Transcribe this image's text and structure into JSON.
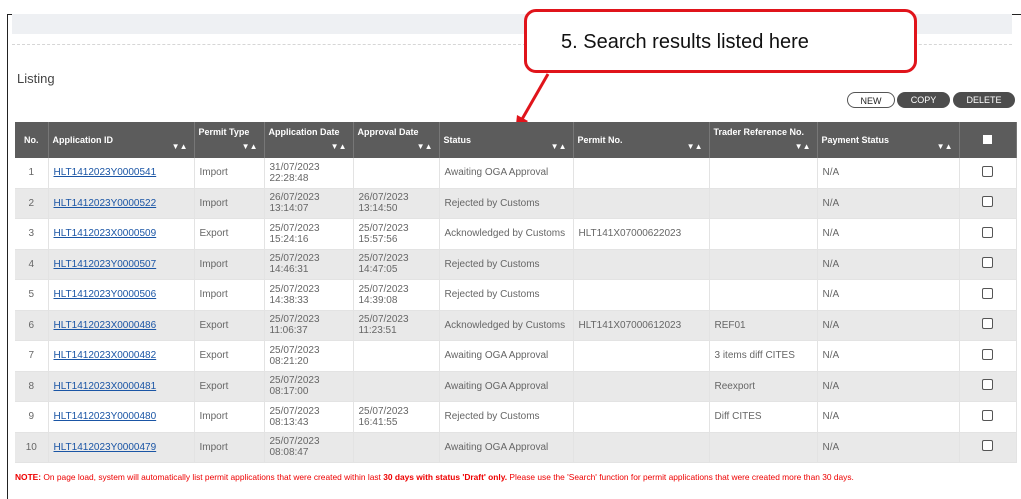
{
  "section_title": "Listing",
  "callout": "5.  Search results listed here",
  "buttons": {
    "new": "NEW",
    "copy": "COPY",
    "delete": "DELETE"
  },
  "table": {
    "headers": [
      "No.",
      "Application ID",
      "Permit Type",
      "Application Date",
      "Approval Date",
      "Status",
      "Permit No.",
      "Trader Reference No.",
      "Payment Status"
    ],
    "sort_glyph": "▼▲",
    "rows": [
      {
        "no": "1",
        "id": "HLT1412023Y0000541",
        "type": "Import",
        "app_date": "31/07/2023 22:28:48",
        "appr_date": "",
        "status": "Awaiting OGA Approval",
        "permit_no": "",
        "trader_ref": "",
        "payment": "N/A"
      },
      {
        "no": "2",
        "id": "HLT1412023Y0000522",
        "type": "Import",
        "app_date": "26/07/2023 13:14:07",
        "appr_date": "26/07/2023 13:14:50",
        "status": "Rejected by Customs",
        "permit_no": "",
        "trader_ref": "",
        "payment": "N/A"
      },
      {
        "no": "3",
        "id": "HLT1412023X0000509",
        "type": "Export",
        "app_date": "25/07/2023 15:24:16",
        "appr_date": "25/07/2023 15:57:56",
        "status": "Acknowledged by Customs",
        "permit_no": "HLT141X07000622023",
        "trader_ref": "",
        "payment": "N/A"
      },
      {
        "no": "4",
        "id": "HLT1412023Y0000507",
        "type": "Import",
        "app_date": "25/07/2023 14:46:31",
        "appr_date": "25/07/2023 14:47:05",
        "status": "Rejected by Customs",
        "permit_no": "",
        "trader_ref": "",
        "payment": "N/A"
      },
      {
        "no": "5",
        "id": "HLT1412023Y0000506",
        "type": "Import",
        "app_date": "25/07/2023 14:38:33",
        "appr_date": "25/07/2023 14:39:08",
        "status": "Rejected by Customs",
        "permit_no": "",
        "trader_ref": "",
        "payment": "N/A"
      },
      {
        "no": "6",
        "id": "HLT1412023X0000486",
        "type": "Export",
        "app_date": "25/07/2023 11:06:37",
        "appr_date": "25/07/2023 11:23:51",
        "status": "Acknowledged by Customs",
        "permit_no": "HLT141X07000612023",
        "trader_ref": "REF01",
        "payment": "N/A"
      },
      {
        "no": "7",
        "id": "HLT1412023X0000482",
        "type": "Export",
        "app_date": "25/07/2023 08:21:20",
        "appr_date": "",
        "status": "Awaiting OGA Approval",
        "permit_no": "",
        "trader_ref": "3 items diff CITES",
        "payment": "N/A"
      },
      {
        "no": "8",
        "id": "HLT1412023X0000481",
        "type": "Export",
        "app_date": "25/07/2023 08:17:00",
        "appr_date": "",
        "status": "Awaiting OGA Approval",
        "permit_no": "",
        "trader_ref": "Reexport",
        "payment": "N/A"
      },
      {
        "no": "9",
        "id": "HLT1412023Y0000480",
        "type": "Import",
        "app_date": "25/07/2023 08:13:43",
        "appr_date": "25/07/2023 16:41:55",
        "status": "Rejected by Customs",
        "permit_no": "",
        "trader_ref": "Diff CITES",
        "payment": "N/A"
      },
      {
        "no": "10",
        "id": "HLT1412023Y0000479",
        "type": "Import",
        "app_date": "25/07/2023 08:08:47",
        "appr_date": "",
        "status": "Awaiting OGA Approval",
        "permit_no": "",
        "trader_ref": "",
        "payment": "N/A"
      }
    ]
  },
  "note": {
    "prefix": "NOTE:",
    "text1": " On page load, system will automatically list permit applications that were created within last ",
    "bold1": "30 days with status 'Draft' only.",
    "text2": " Please use the 'Search' function for permit applications that were created more than 30 days."
  },
  "colors": {
    "callout_border": "#e0141b",
    "header_bg": "#5c5c5c",
    "link": "#1a55a5",
    "note": "#e00000"
  }
}
